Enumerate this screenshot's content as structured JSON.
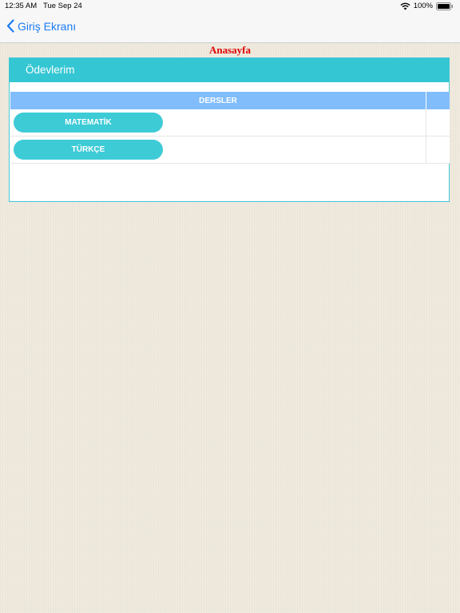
{
  "status_bar": {
    "time": "12:35 AM",
    "date": "Tue Sep 24",
    "battery_percent": "100%",
    "icons": [
      "wifi-icon",
      "battery-icon"
    ]
  },
  "nav": {
    "back_label": "Giriş Ekranı",
    "back_icon": "chevron-left-icon",
    "accent_color": "#1c7cf4"
  },
  "page": {
    "title": "Anasayfa",
    "title_color": "#e00000"
  },
  "panel": {
    "header": "Ödevlerim",
    "header_color": "#34c6d3",
    "table": {
      "columns": [
        "DERSLER"
      ],
      "header_color": "#81bdfb",
      "rows": [
        {
          "subject": "MATEMATİK"
        },
        {
          "subject": "TÜRKÇE"
        }
      ]
    }
  }
}
